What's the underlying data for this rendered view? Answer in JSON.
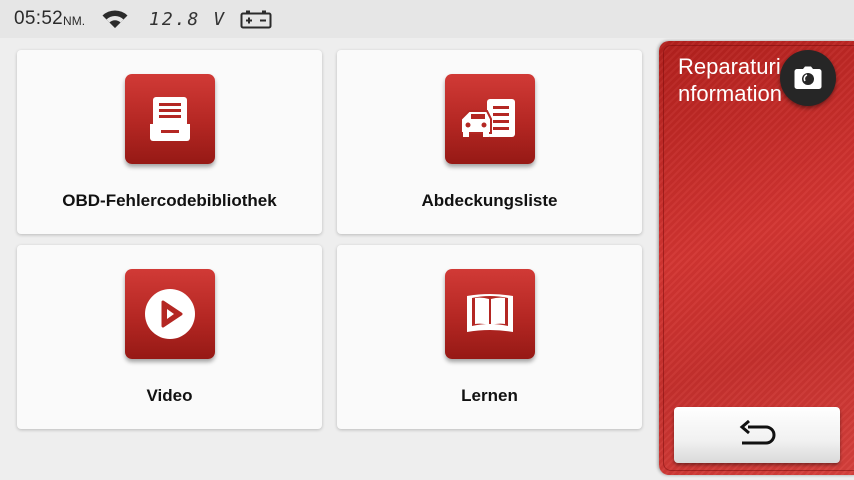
{
  "status_bar": {
    "time": "05:52",
    "ampm": "NM.",
    "voltage": "12.8 V",
    "icons": [
      "wifi-icon",
      "battery-icon"
    ]
  },
  "tiles": [
    {
      "label": "OBD-Fehlercodebibliothek",
      "icon": "obd-library-icon"
    },
    {
      "label": "Abdeckungsliste",
      "icon": "coverage-list-icon"
    },
    {
      "label": "Video",
      "icon": "video-play-icon"
    },
    {
      "label": "Lernen",
      "icon": "book-icon"
    }
  ],
  "side_panel": {
    "title": "Reparaturinformationen",
    "camera_icon": "camera-icon",
    "back_icon": "back-arrow-icon"
  },
  "colors": {
    "accent": "#c62d29",
    "background": "#eeeeee",
    "tile": "#fafafa"
  }
}
